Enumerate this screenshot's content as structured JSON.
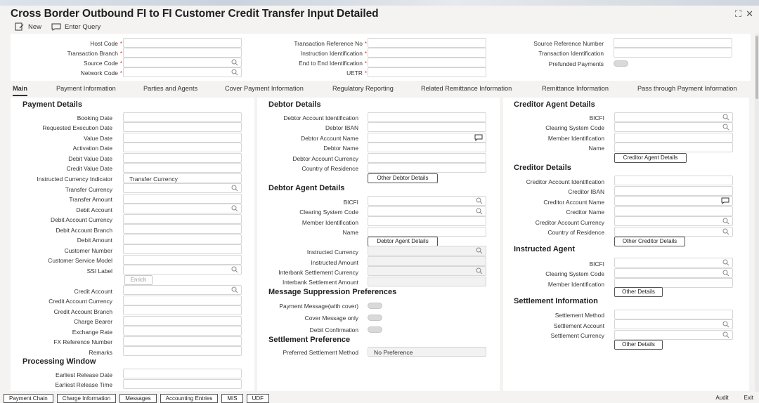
{
  "title": "Cross Border Outbound FI to FI Customer Credit Transfer Input Detailed",
  "toolbar": {
    "new_label": "New",
    "enter_query_label": "Enter Query"
  },
  "header": {
    "host_code": "Host Code",
    "transaction_branch": "Transaction Branch",
    "source_code": "Source Code",
    "network_code": "Network Code",
    "transaction_reference_no": "Transaction Reference No",
    "instruction_identification": "Instruction Identification",
    "end_to_end_identification": "End to End Identification",
    "uetr": "UETR",
    "source_reference_number": "Source Reference Number",
    "transaction_identification": "Transaction Identification",
    "prefunded_payments": "Prefunded Payments"
  },
  "tabs": [
    "Main",
    "Payment Information",
    "Parties and Agents",
    "Cover Payment Information",
    "Regulatory Reporting",
    "Related Remittance Information",
    "Remittance Information",
    "Pass through Payment Information"
  ],
  "payment_details": {
    "title": "Payment Details",
    "booking_date": "Booking Date",
    "requested_execution_date": "Requested Execution Date",
    "value_date": "Value Date",
    "activation_date": "Activation Date",
    "debit_value_date": "Debit Value Date",
    "credit_value_date": "Credit Value Date",
    "instructed_currency_indicator": "Instructed Currency Indicator",
    "instructed_currency_indicator_value": "Transfer Currency",
    "transfer_currency": "Transfer Currency",
    "transfer_amount": "Transfer Amount",
    "debit_account": "Debit Account",
    "debit_account_currency": "Debit Account Currency",
    "debit_account_branch": "Debit Account Branch",
    "debit_amount": "Debit Amount",
    "customer_number": "Customer Number",
    "customer_service_model": "Customer Service Model",
    "ssi_label": "SSI Label",
    "enrich_button": "Enrich",
    "credit_account": "Credit Account",
    "credit_account_currency": "Credit Account Currency",
    "credit_account_branch": "Credit Account Branch",
    "charge_bearer": "Charge Bearer",
    "exchange_rate": "Exchange Rate",
    "fx_reference_number": "FX Reference Number",
    "remarks": "Remarks"
  },
  "processing_window": {
    "title": "Processing Window",
    "earliest_release_date": "Earliest Release Date",
    "earliest_release_time": "Earliest Release Time"
  },
  "debtor_details": {
    "title": "Debtor Details",
    "debtor_account_identification": "Debtor Account Identification",
    "debtor_iban": "Debtor IBAN",
    "debtor_account_name": "Debtor Account Name",
    "debtor_name": "Debtor Name",
    "debtor_account_currency": "Debtor Account Currency",
    "country_of_residence": "Country of Residence",
    "other_button": "Other Debtor Details"
  },
  "debtor_agent": {
    "title": "Debtor Agent Details",
    "bicfi": "BICFI",
    "clearing_system_code": "Clearing System Code",
    "member_identification": "Member Identification",
    "name": "Name",
    "button": "Debtor Agent Details",
    "instructed_currency": "Instructed Currency",
    "instructed_amount": "Instructed Amount",
    "interbank_settlement_currency": "Interbank Settlement Currency",
    "interbank_settlement_amount": "Interbank Settlement Amount"
  },
  "message_suppression": {
    "title": "Message Suppression Preferences",
    "payment_message_with_cover": "Payment Message(with cover)",
    "cover_message_only": "Cover Message only",
    "debit_confirmation": "Debit Confirmation"
  },
  "settlement_preference": {
    "title": "Settlement Preference",
    "preferred_settlement_method": "Preferred Settlement Method",
    "preferred_settlement_method_value": "No Preference"
  },
  "creditor_agent": {
    "title": "Creditor Agent Details",
    "bicfi": "BICFI",
    "clearing_system_code": "Clearing System Code",
    "member_identification": "Member Identification",
    "name": "Name",
    "button": "Creditor Agent Details"
  },
  "creditor_details": {
    "title": "Creditor Details",
    "creditor_account_identification": "Creditor Account Identification",
    "creditor_iban": "Creditor IBAN",
    "creditor_account_name": "Creditor Account Name",
    "creditor_name": "Creditor Name",
    "creditor_account_currency": "Creditor Account Currency",
    "country_of_residence": "Country of Residence",
    "button": "Other Creditor Details"
  },
  "instructed_agent": {
    "title": "Instructed Agent",
    "bicfi": "BICFI",
    "clearing_system_code": "Clearing System Code",
    "member_identification": "Member Identification",
    "button": "Other Details"
  },
  "settlement_information": {
    "title": "Settlement Information",
    "settlement_method": "Settlement Method",
    "settlement_account": "Settlement Account",
    "settlement_currency": "Settlement Currency",
    "button": "Other Details"
  },
  "bottom_bar": {
    "buttons": [
      "Payment Chain",
      "Charge Information",
      "Messages",
      "Accounting Entries",
      "MIS",
      "UDF"
    ],
    "audit": "Audit",
    "exit": "Exit"
  }
}
